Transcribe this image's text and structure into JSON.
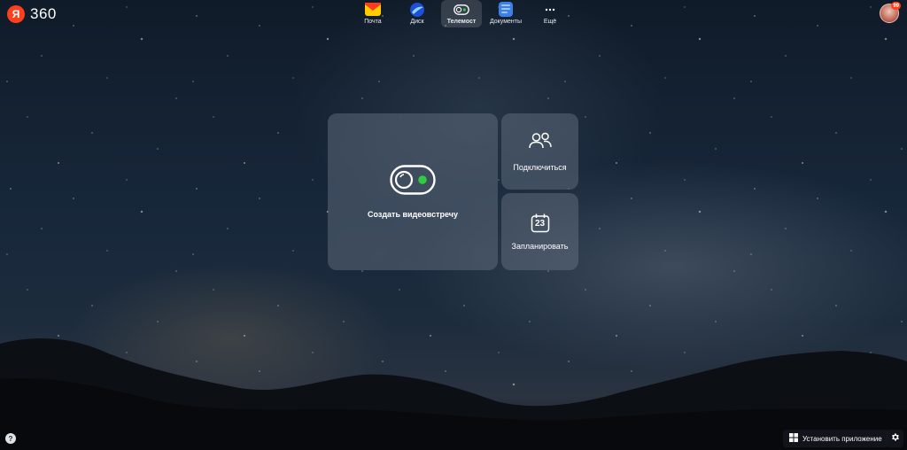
{
  "logo": {
    "badge": "Я",
    "text": "360"
  },
  "apps": [
    {
      "label": "Почта",
      "icon": "mail-icon"
    },
    {
      "label": "Диск",
      "icon": "disk-icon"
    },
    {
      "label": "Телемост",
      "icon": "telemost-icon",
      "active": true
    },
    {
      "label": "Документы",
      "icon": "documents-icon"
    },
    {
      "label": "Ещё",
      "icon": "more-icon"
    }
  ],
  "avatar": {
    "badge": "99"
  },
  "cards": {
    "create": {
      "label": "Создать видеовстречу",
      "icon": "camera-toggle-icon"
    },
    "join": {
      "label": "Подключиться",
      "icon": "people-icon"
    },
    "schedule": {
      "label": "Запланировать",
      "icon": "calendar-icon",
      "day": "23"
    }
  },
  "footer": {
    "help": "?",
    "install_label": "Установить приложение",
    "install_icon": "windows-icon",
    "settings_icon": "gear-icon"
  },
  "colors": {
    "brand": "#fc3f1d",
    "accent_green": "#2ecc40"
  }
}
